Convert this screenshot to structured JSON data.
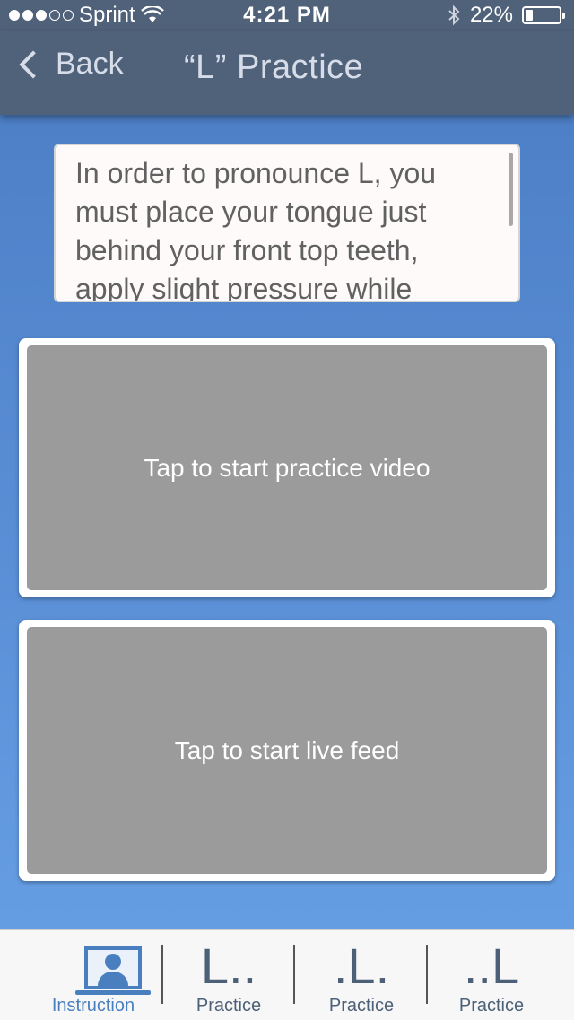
{
  "status_bar": {
    "carrier": "Sprint",
    "signal_bars": 3,
    "signal_total": 5,
    "time": "4:21 PM",
    "battery": "22%",
    "battery_level": 0.22
  },
  "nav": {
    "back_label": "Back",
    "title": "“L”  Practice"
  },
  "instruction": {
    "text": "In order to pronounce L, you must place your tongue just behind your front top teeth, apply slight pressure while"
  },
  "video_panel": {
    "label": "Tap to start practice video"
  },
  "live_panel": {
    "label": "Tap to start live feed"
  },
  "tabs": [
    {
      "label": "Instruction",
      "icon": "instructor-monitor-icon",
      "active": true
    },
    {
      "glyph": "L..",
      "label": "Practice",
      "icon": "l-initial-icon"
    },
    {
      "glyph": ".L.",
      "label": "Practice",
      "icon": "l-medial-icon"
    },
    {
      "glyph": "..L",
      "label": "Practice",
      "icon": "l-final-icon"
    }
  ],
  "colors": {
    "navbar": "#50617a",
    "background_top": "#4a7cc3",
    "background_bottom": "#68a1e6",
    "panel_gray": "#9b9b9b",
    "tab_active": "#4a7fbf"
  }
}
